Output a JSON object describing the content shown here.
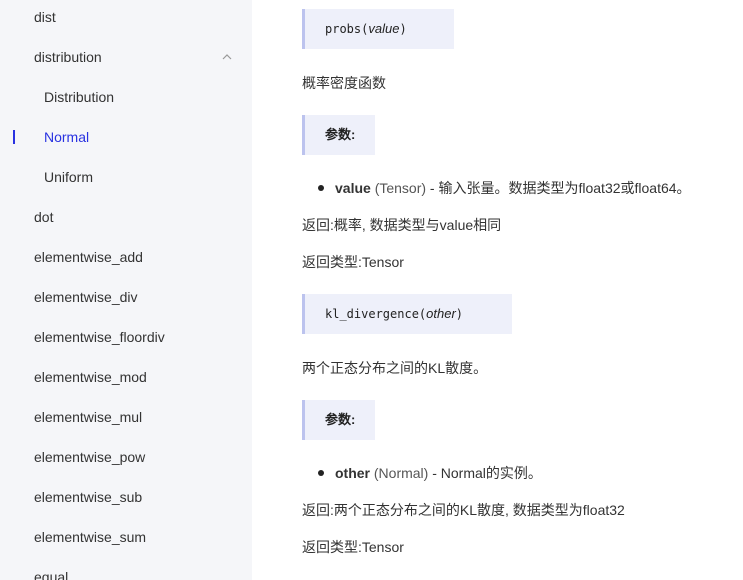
{
  "sidebar": {
    "items": [
      {
        "label": "dist"
      },
      {
        "label": "distribution",
        "expanded": true
      },
      {
        "label": "Distribution"
      },
      {
        "label": "Normal",
        "active": true
      },
      {
        "label": "Uniform"
      },
      {
        "label": "dot"
      },
      {
        "label": "elementwise_add"
      },
      {
        "label": "elementwise_div"
      },
      {
        "label": "elementwise_floordiv"
      },
      {
        "label": "elementwise_mod"
      },
      {
        "label": "elementwise_mul"
      },
      {
        "label": "elementwise_pow"
      },
      {
        "label": "elementwise_sub"
      },
      {
        "label": "elementwise_sum"
      },
      {
        "label": "equal"
      }
    ]
  },
  "content": {
    "probs": {
      "name": "probs",
      "arg": "value",
      "desc": "概率密度函数",
      "params_heading": "参数:",
      "param": {
        "name": "value",
        "type": " (Tensor)",
        "desc": " - 输入张量。数据类型为float32或float64。"
      },
      "returns": "返回:概率, 数据类型与value相同",
      "return_type": "返回类型:Tensor"
    },
    "kl": {
      "name": "kl_divergence",
      "arg": "other",
      "desc": "两个正态分布之间的KL散度。",
      "params_heading": "参数:",
      "param": {
        "name": "other",
        "type": " (Normal)",
        "desc": " - Normal的实例。"
      },
      "returns": "返回:两个正态分布之间的KL散度, 数据类型为float32",
      "return_type": "返回类型:Tensor"
    }
  },
  "colors": {
    "accent": "#2932e1",
    "sidebar_bg": "#f5f6f9",
    "code_bg": "#eef0fa"
  }
}
